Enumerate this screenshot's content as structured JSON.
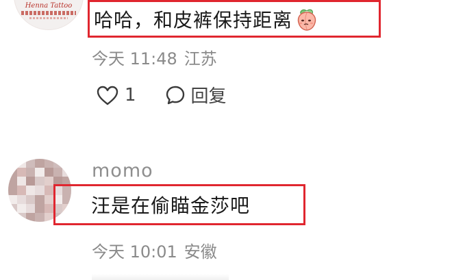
{
  "comments": [
    {
      "brand_text": "Henna Tattoo",
      "text": "哈哈，和皮裤保持距离",
      "emoji_icon": "peach-emoji",
      "time": "今天 11:48",
      "location": "江苏",
      "like_count": "1",
      "reply_label": "回复"
    },
    {
      "username": "momo",
      "text": "汪是在偷瞄金莎吧",
      "time": "今天 10:01",
      "location": "安徽"
    }
  ],
  "colors": {
    "highlight_border": "#e0262f",
    "meta_text": "#8a8a8a",
    "body_text": "#1a1a1a"
  }
}
